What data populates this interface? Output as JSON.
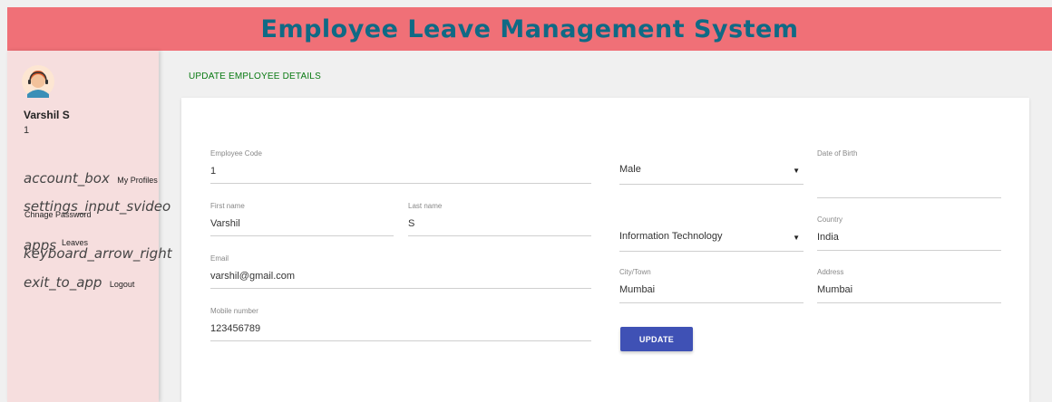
{
  "header": {
    "title": "Employee Leave Management System"
  },
  "sidebar": {
    "user_name": "Varshil S",
    "user_id": "1",
    "items": [
      {
        "icon": "account_box",
        "label": "My Profiles"
      },
      {
        "icon": "settings_input_svideo",
        "label": "Chnage Password"
      },
      {
        "icon": "apps",
        "label": "Leaves",
        "icon2": "keyboard_arrow_right"
      },
      {
        "icon": "exit_to_app",
        "label": "Logout"
      }
    ]
  },
  "page": {
    "title": "UPDATE EMPLOYEE DETAILS"
  },
  "form": {
    "employee_code": {
      "label": "Employee Code",
      "value": "1"
    },
    "first_name": {
      "label": "First name",
      "value": "Varshil"
    },
    "last_name": {
      "label": "Last name",
      "value": "S"
    },
    "email": {
      "label": "Email",
      "value": "varshil@gmail.com"
    },
    "mobile": {
      "label": "Mobile number",
      "value": "123456789"
    },
    "gender": {
      "value": "Male"
    },
    "dob": {
      "label": "Date of Birth",
      "value": ""
    },
    "department": {
      "value": "Information Technology"
    },
    "country": {
      "label": "Country",
      "value": "India"
    },
    "city": {
      "label": "City/Town",
      "value": "Mumbai"
    },
    "address": {
      "label": "Address",
      "value": "Mumbai"
    },
    "submit_label": "UPDATE"
  },
  "colors": {
    "header_bg": "#f07077",
    "header_text": "#0f6a85",
    "sidebar_bg": "#f6dede",
    "title_green": "#0a7a13",
    "button_blue": "#3f51b5"
  }
}
